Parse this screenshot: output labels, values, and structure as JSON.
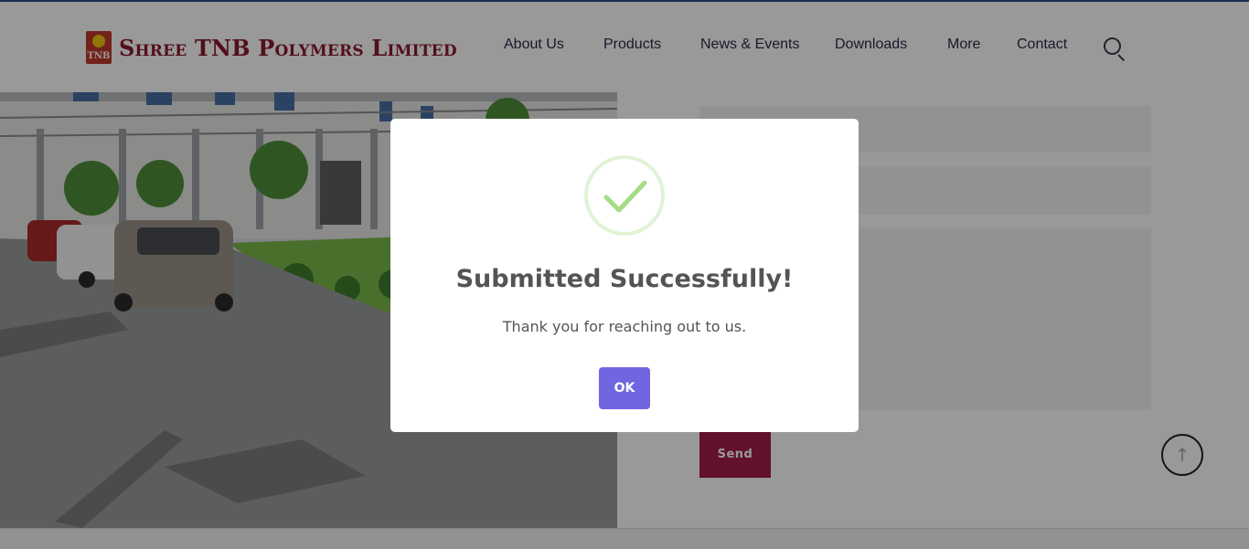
{
  "brand": {
    "name": "Shree TNB Polymers Limited",
    "mark_text": "TNB",
    "color": "#8b1a2f"
  },
  "nav": {
    "items": [
      {
        "label": "About Us"
      },
      {
        "label": "Products"
      },
      {
        "label": "News & Events"
      },
      {
        "label": "Downloads"
      },
      {
        "label": "More"
      },
      {
        "label": "Contact"
      }
    ],
    "search_icon": "search-icon"
  },
  "form": {
    "send_label": "Send",
    "send_color": "#a31c4a"
  },
  "modal": {
    "icon": "success-check-icon",
    "title": "Submitted Successfully!",
    "message": "Thank you for reaching out to us.",
    "ok_label": "OK",
    "ok_color": "#7066e0",
    "check_color": "#a5dc86"
  },
  "scroll_top_icon": "arrow-up-icon"
}
